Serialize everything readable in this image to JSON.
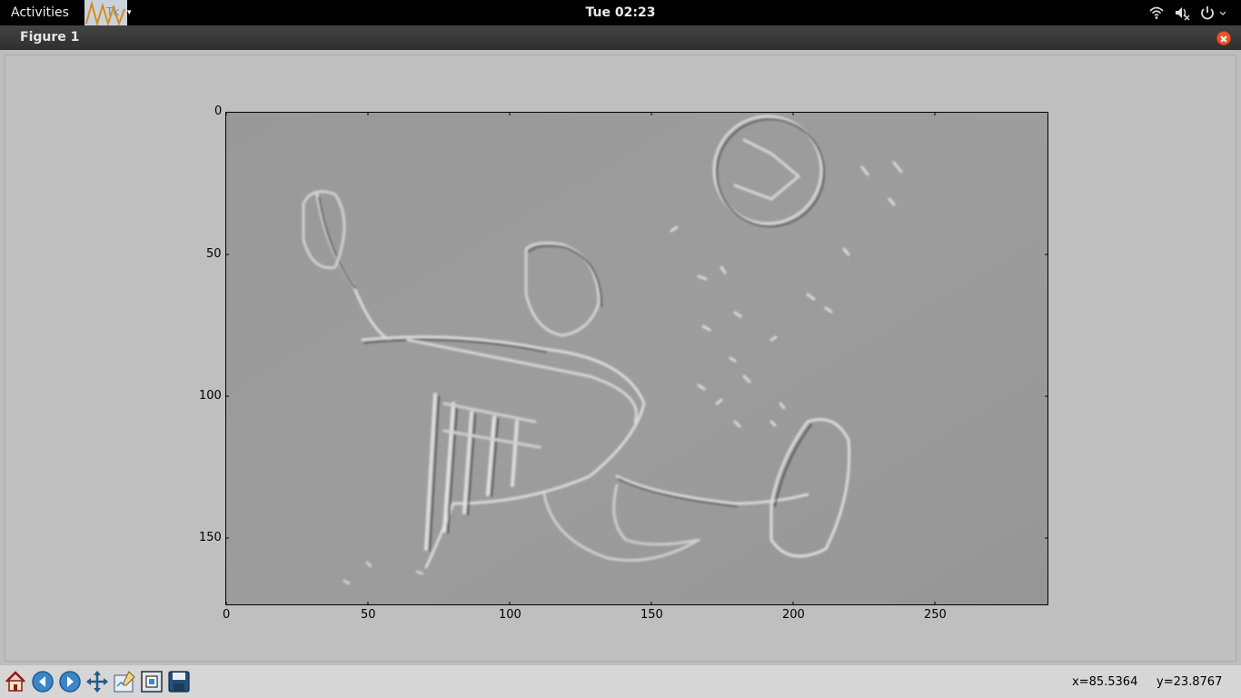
{
  "topbar": {
    "activities_label": "Activities",
    "app_label": "Tk",
    "clock": "Tue 02:23",
    "tray_icons": [
      "wifi-icon",
      "volume-muted-icon",
      "power-icon"
    ]
  },
  "window": {
    "title": "Figure 1"
  },
  "figure": {
    "x_ticks": [
      "0",
      "50",
      "100",
      "150",
      "200",
      "250"
    ],
    "y_ticks": [
      "0",
      "50",
      "100",
      "150"
    ],
    "image_description_icon": "embossed-photo-football-player-bicycle-kick"
  },
  "toolbar": {
    "buttons": [
      "home-icon",
      "back-icon",
      "forward-icon",
      "pan-icon",
      "configure-subplots-icon",
      "zoom-to-rect-icon",
      "save-icon"
    ]
  },
  "status": {
    "x_readout": "x=85.5364",
    "y_readout": "y=23.8767"
  },
  "colors": {
    "plot_gray": "#9a9a9a",
    "canvas_bg": "#bfbfbf",
    "close_button": "#e8562b"
  }
}
